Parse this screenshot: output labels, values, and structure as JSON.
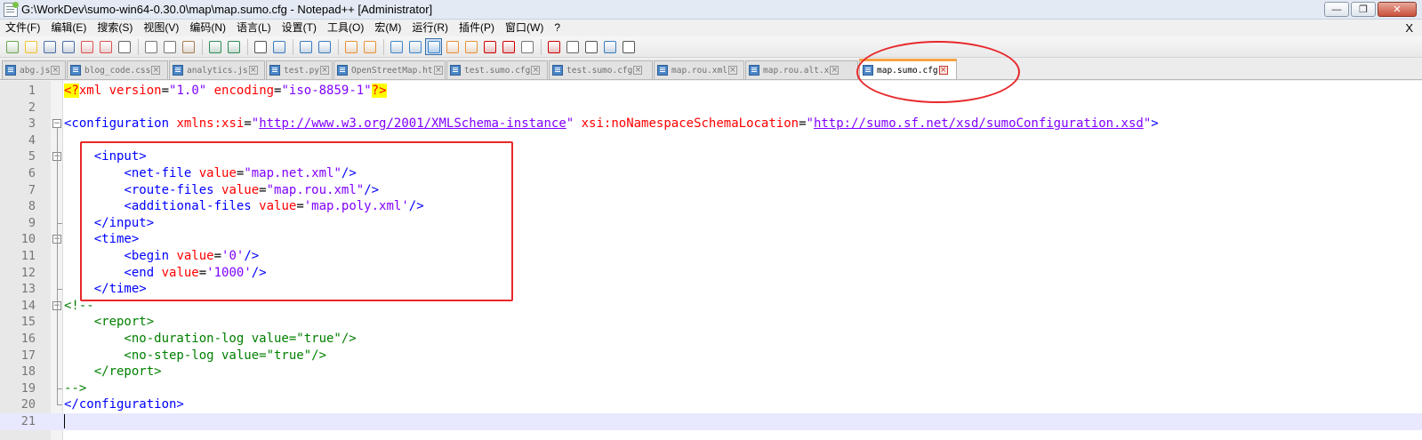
{
  "window": {
    "title": "G:\\WorkDev\\sumo-win64-0.30.0\\map\\map.sumo.cfg - Notepad++ [Administrator]",
    "minimize_icon": "minimize-icon",
    "restore_icon": "restore-icon",
    "close_icon": "close-icon"
  },
  "menu": {
    "items": [
      "文件(F)",
      "编辑(E)",
      "搜索(S)",
      "视图(V)",
      "编码(N)",
      "语言(L)",
      "设置(T)",
      "工具(O)",
      "宏(M)",
      "运行(R)",
      "插件(P)",
      "窗口(W)",
      "?"
    ],
    "close": "X"
  },
  "toolbar": {
    "icons": [
      "new-file-icon",
      "open-file-icon",
      "save-icon",
      "save-all-icon",
      "close-icon",
      "close-all-icon",
      "print-icon",
      "cut-icon",
      "copy-icon",
      "paste-icon",
      "undo-icon",
      "redo-icon",
      "find-icon",
      "replace-icon",
      "zoom-in-icon",
      "zoom-out-icon",
      "sync-vertical-icon",
      "sync-horizontal-icon",
      "word-wrap-icon",
      "show-all-chars-icon",
      "indent-guide-icon",
      "user-lang-icon",
      "doc-map-icon",
      "function-list-icon",
      "folder-workspace-icon",
      "monitor-icon",
      "record-macro-icon",
      "stop-record-icon",
      "play-macro-icon",
      "run-macro-multiple-icon",
      "save-macro-icon"
    ]
  },
  "tabs": [
    {
      "label": "abg.js",
      "active": false
    },
    {
      "label": "blog_code.css",
      "active": false
    },
    {
      "label": "analytics.js",
      "active": false
    },
    {
      "label": "test.py",
      "active": false
    },
    {
      "label": "OpenStreetMap.html",
      "active": false
    },
    {
      "label": "test.sumo.cfg",
      "active": false
    },
    {
      "label": "test.sumo.cfg",
      "active": false
    },
    {
      "label": "map.rou.xml",
      "active": false
    },
    {
      "label": "map.rou.alt.x",
      "active": false
    },
    {
      "label": "map.sumo.cfg",
      "active": true
    }
  ],
  "editor": {
    "current_line": 21,
    "lines": [
      {
        "n": "1",
        "tokens": [
          [
            "pi",
            "<?"
          ],
          [
            "piname",
            "xml"
          ],
          [
            "attr",
            " version"
          ],
          [
            "punct",
            "="
          ],
          [
            "val",
            "\"1.0\""
          ],
          [
            "attr",
            " encoding"
          ],
          [
            "punct",
            "="
          ],
          [
            "val",
            "\"iso-8859-1\""
          ],
          [
            "pi",
            "?>"
          ]
        ]
      },
      {
        "n": "2",
        "tokens": []
      },
      {
        "n": "3",
        "tokens": [
          [
            "tag",
            "<configuration"
          ],
          [
            "attr",
            " xmlns:xsi"
          ],
          [
            "punct",
            "="
          ],
          [
            "val",
            "\""
          ],
          [
            "url",
            "http://www.w3.org/2001/XMLSchema-instance"
          ],
          [
            "val",
            "\""
          ],
          [
            "attr",
            " xsi:noNamespaceSchemaLocation"
          ],
          [
            "punct",
            "="
          ],
          [
            "val",
            "\""
          ],
          [
            "url",
            "http://sumo.sf.net/xsd/sumoConfiguration.xsd"
          ],
          [
            "val",
            "\""
          ],
          [
            "tag",
            ">"
          ]
        ]
      },
      {
        "n": "4",
        "tokens": []
      },
      {
        "n": "5",
        "tokens": [
          [
            "punct",
            "    "
          ],
          [
            "tag",
            "<input>"
          ]
        ]
      },
      {
        "n": "6",
        "tokens": [
          [
            "punct",
            "        "
          ],
          [
            "tag",
            "<net-file"
          ],
          [
            "attr",
            " value"
          ],
          [
            "punct",
            "="
          ],
          [
            "val",
            "\"map.net.xml\""
          ],
          [
            "tag",
            "/>"
          ]
        ]
      },
      {
        "n": "7",
        "tokens": [
          [
            "punct",
            "        "
          ],
          [
            "tag",
            "<route-files"
          ],
          [
            "attr",
            " value"
          ],
          [
            "punct",
            "="
          ],
          [
            "val",
            "\"map.rou.xml\""
          ],
          [
            "tag",
            "/>"
          ]
        ]
      },
      {
        "n": "8",
        "tokens": [
          [
            "punct",
            "        "
          ],
          [
            "tag",
            "<additional-files"
          ],
          [
            "attr",
            " value"
          ],
          [
            "punct",
            "="
          ],
          [
            "val",
            "'map.poly.xml'"
          ],
          [
            "tag",
            "/>"
          ]
        ]
      },
      {
        "n": "9",
        "tokens": [
          [
            "punct",
            "    "
          ],
          [
            "tag",
            "</input>"
          ]
        ]
      },
      {
        "n": "10",
        "tokens": [
          [
            "punct",
            "    "
          ],
          [
            "tag",
            "<time>"
          ]
        ]
      },
      {
        "n": "11",
        "tokens": [
          [
            "punct",
            "        "
          ],
          [
            "tag",
            "<begin"
          ],
          [
            "attr",
            " value"
          ],
          [
            "punct",
            "="
          ],
          [
            "val",
            "'0'"
          ],
          [
            "tag",
            "/>"
          ]
        ]
      },
      {
        "n": "12",
        "tokens": [
          [
            "punct",
            "        "
          ],
          [
            "tag",
            "<end"
          ],
          [
            "attr",
            " value"
          ],
          [
            "punct",
            "="
          ],
          [
            "val",
            "'1000'"
          ],
          [
            "tag",
            "/>"
          ]
        ]
      },
      {
        "n": "13",
        "tokens": [
          [
            "punct",
            "    "
          ],
          [
            "tag",
            "</time>"
          ]
        ]
      },
      {
        "n": "14",
        "tokens": [
          [
            "comment",
            "<!--"
          ]
        ]
      },
      {
        "n": "15",
        "tokens": [
          [
            "comment",
            "    <report>"
          ]
        ]
      },
      {
        "n": "16",
        "tokens": [
          [
            "comment",
            "        <no-duration-log value=\"true\"/>"
          ]
        ]
      },
      {
        "n": "17",
        "tokens": [
          [
            "comment",
            "        <no-step-log value=\"true\"/>"
          ]
        ]
      },
      {
        "n": "18",
        "tokens": [
          [
            "comment",
            "    </report>"
          ]
        ]
      },
      {
        "n": "19",
        "tokens": [
          [
            "comment",
            "-->"
          ]
        ]
      },
      {
        "n": "20",
        "tokens": [
          [
            "tag",
            "</configuration>"
          ]
        ]
      },
      {
        "n": "21",
        "tokens": []
      }
    ]
  },
  "colors": {
    "tag": "#0000ff",
    "attr": "#ff0000",
    "value": "#8000ff",
    "comment": "#008000",
    "annotation": "#e8282a",
    "active_tab_accent": "#f6a343"
  }
}
